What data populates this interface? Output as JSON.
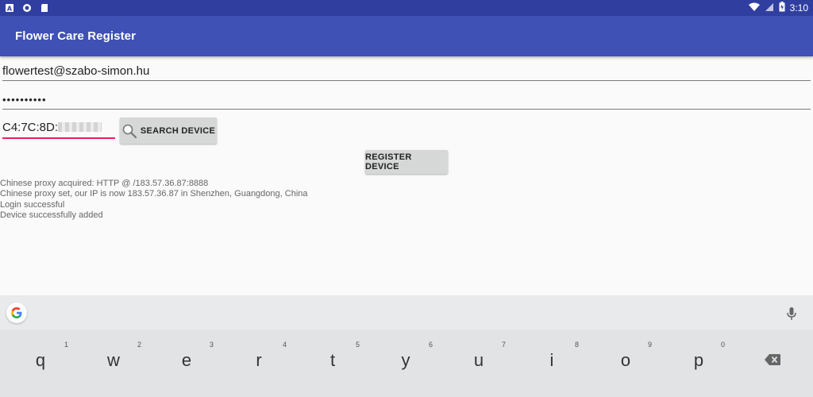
{
  "statusbar": {
    "time": "3:10"
  },
  "appbar": {
    "title": "Flower Care Register"
  },
  "form": {
    "email": "flowertest@szabo-simon.hu",
    "password": "••••••••••",
    "mac": "C4:7C:8D:"
  },
  "buttons": {
    "search": "SEARCH DEVICE",
    "register": "REGISTER DEVICE"
  },
  "log": [
    "Chinese proxy acquired: HTTP @ /183.57.36.87:8888",
    "Chinese proxy set, our IP is now 183.57.36.87 in Shenzhen, Guangdong, China",
    "Login successful",
    "Device successfully added"
  ],
  "keyboard": {
    "keys": [
      {
        "letter": "q",
        "hint": "1"
      },
      {
        "letter": "w",
        "hint": "2"
      },
      {
        "letter": "e",
        "hint": "3"
      },
      {
        "letter": "r",
        "hint": "4"
      },
      {
        "letter": "t",
        "hint": "5"
      },
      {
        "letter": "y",
        "hint": "6"
      },
      {
        "letter": "u",
        "hint": "7"
      },
      {
        "letter": "i",
        "hint": "8"
      },
      {
        "letter": "o",
        "hint": "9"
      },
      {
        "letter": "p",
        "hint": "0"
      }
    ]
  },
  "colors": {
    "statusbar": "#303f9f",
    "appbar": "#3f51b5",
    "accent": "#e91e63"
  },
  "icons": [
    "android-notification-icon",
    "circle-icon",
    "sd-card-icon",
    "wifi-icon",
    "signal-icon",
    "battery-icon",
    "search-icon",
    "google-icon",
    "mic-icon",
    "backspace-icon"
  ]
}
